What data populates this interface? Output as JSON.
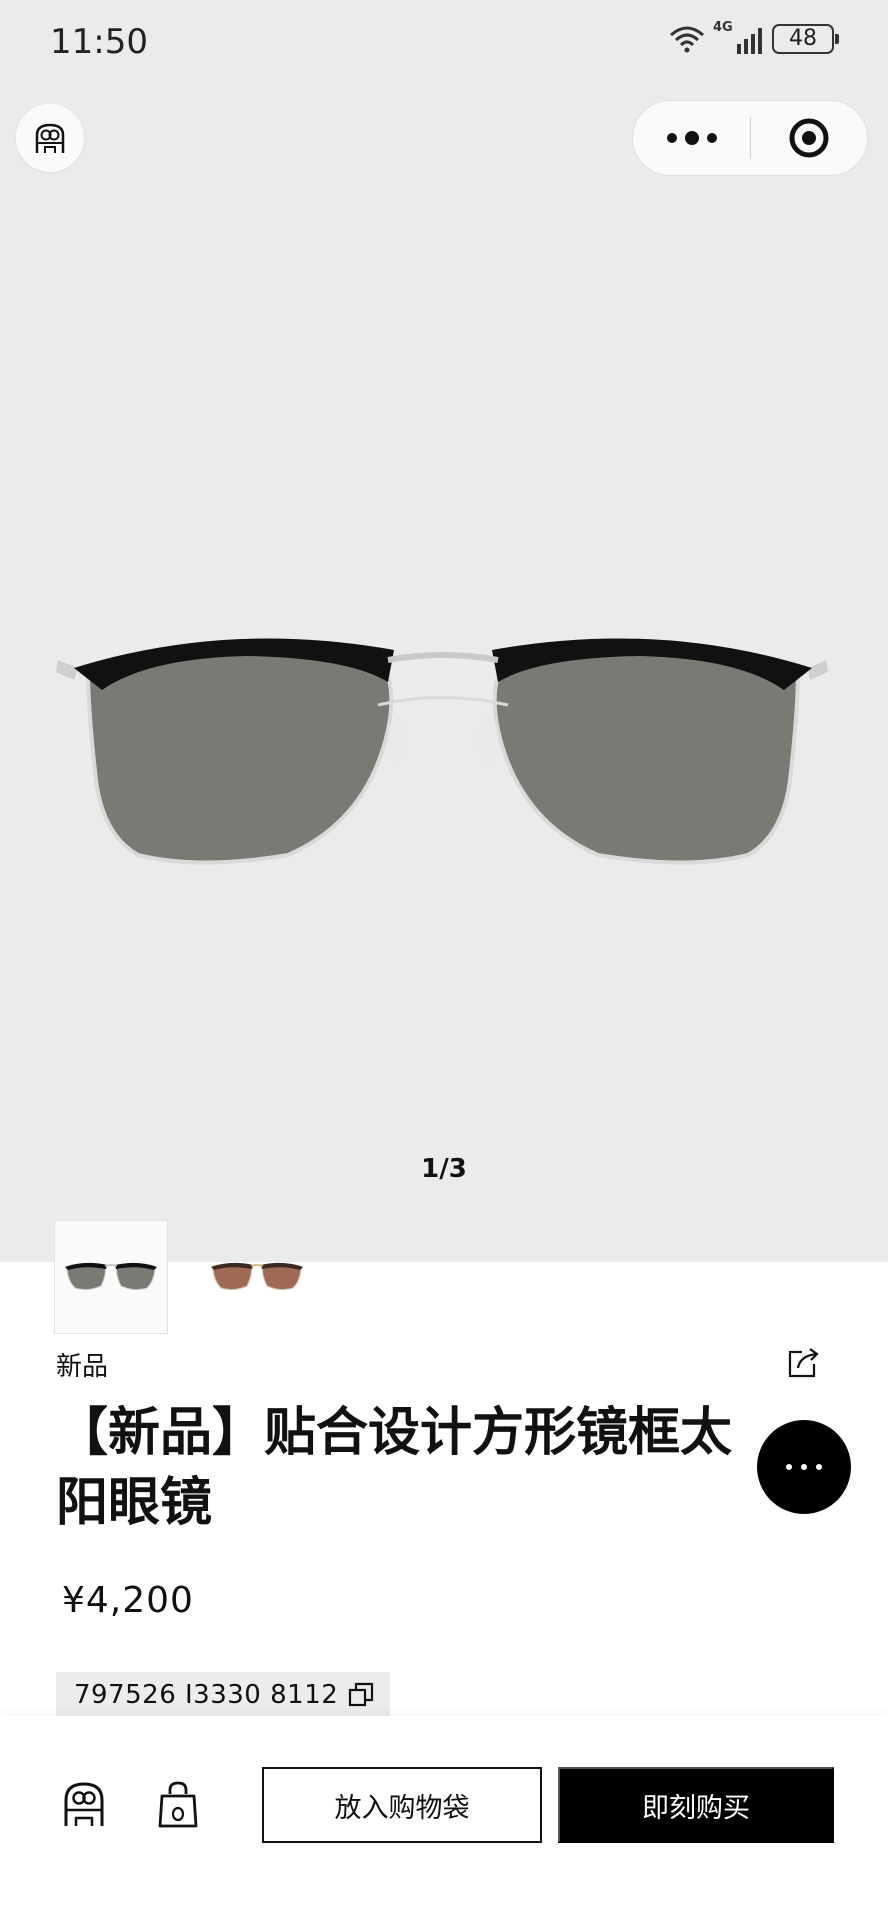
{
  "status": {
    "time": "11:50",
    "network": "4G",
    "battery": "48"
  },
  "gallery": {
    "pager": "1/3"
  },
  "product": {
    "tag": "新品",
    "title": "【新品】贴合设计方形镜框太阳眼镜",
    "price": "¥4,200",
    "sku": "797526 I3330 8112"
  },
  "actions": {
    "add_to_bag": "放入购物袋",
    "buy_now": "即刻购买"
  },
  "icons": {
    "logo": "gucci-logo-icon",
    "more": "more-dots-icon",
    "close": "mini-program-close-icon",
    "share": "share-icon",
    "fab": "ellipsis-icon",
    "copy": "copy-icon",
    "home": "store-home-icon",
    "bag": "shopping-bag-icon"
  },
  "colors": {
    "accent": "#000000",
    "hero_bg": "#ebebeb"
  }
}
